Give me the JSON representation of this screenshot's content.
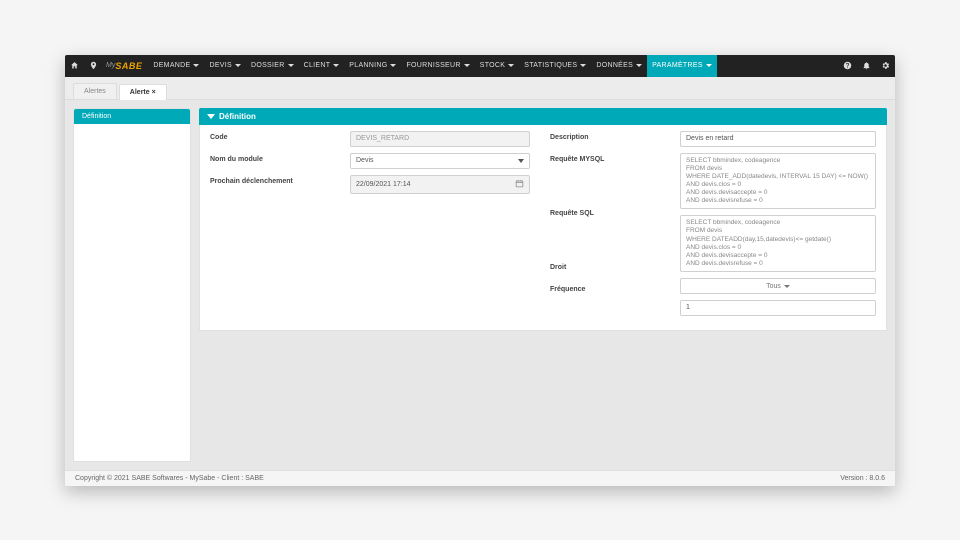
{
  "brand": {
    "prefix": "My",
    "name": "SABE"
  },
  "nav": {
    "items": [
      {
        "label": "DEMANDE"
      },
      {
        "label": "DEVIS"
      },
      {
        "label": "DOSSIER"
      },
      {
        "label": "CLIENT"
      },
      {
        "label": "PLANNING"
      },
      {
        "label": "FOURNISSEUR"
      },
      {
        "label": "STOCK"
      },
      {
        "label": "STATISTIQUES"
      },
      {
        "label": "DONNÉES"
      },
      {
        "label": "PARAMÈTRES"
      }
    ]
  },
  "tabs": {
    "items": [
      {
        "label": "Alertes"
      },
      {
        "label": "Alerte ×"
      }
    ]
  },
  "side": {
    "definition": "Définition"
  },
  "panel": {
    "title": "Définition"
  },
  "labels": {
    "code": "Code",
    "module": "Nom du module",
    "declenchement": "Prochain déclenchement",
    "description": "Description",
    "mysql": "Requête MYSQL",
    "sql": "Requête SQL",
    "droit": "Droit",
    "frequence": "Fréquence"
  },
  "values": {
    "code": "DEVIS_RETARD",
    "module": "Devis",
    "declenchement": "22/09/2021 17:14",
    "description": "Devis en retard",
    "mysql": "SELECT bbmindex, codeagence\nFROM devis\nWHERE DATE_ADD(datedevis, INTERVAL 15 DAY) <= NOW()\nAND devis.clos = 0\nAND devis.devisaccepte = 0\nAND devis.devisrefuse = 0",
    "sql": "SELECT bbmindex, codeagence\nFROM devis\nWHERE DATEADD(day,15,datedevis)<= getdate()\nAND devis.clos = 0\nAND devis.devisaccepte = 0\nAND devis.devisrefuse = 0",
    "droit": "Tous",
    "frequence": "1"
  },
  "footer": {
    "left": "Copyright © 2021 SABE Softwares - MySabe - Client : SABE",
    "right": "Version : 8.0.6"
  }
}
